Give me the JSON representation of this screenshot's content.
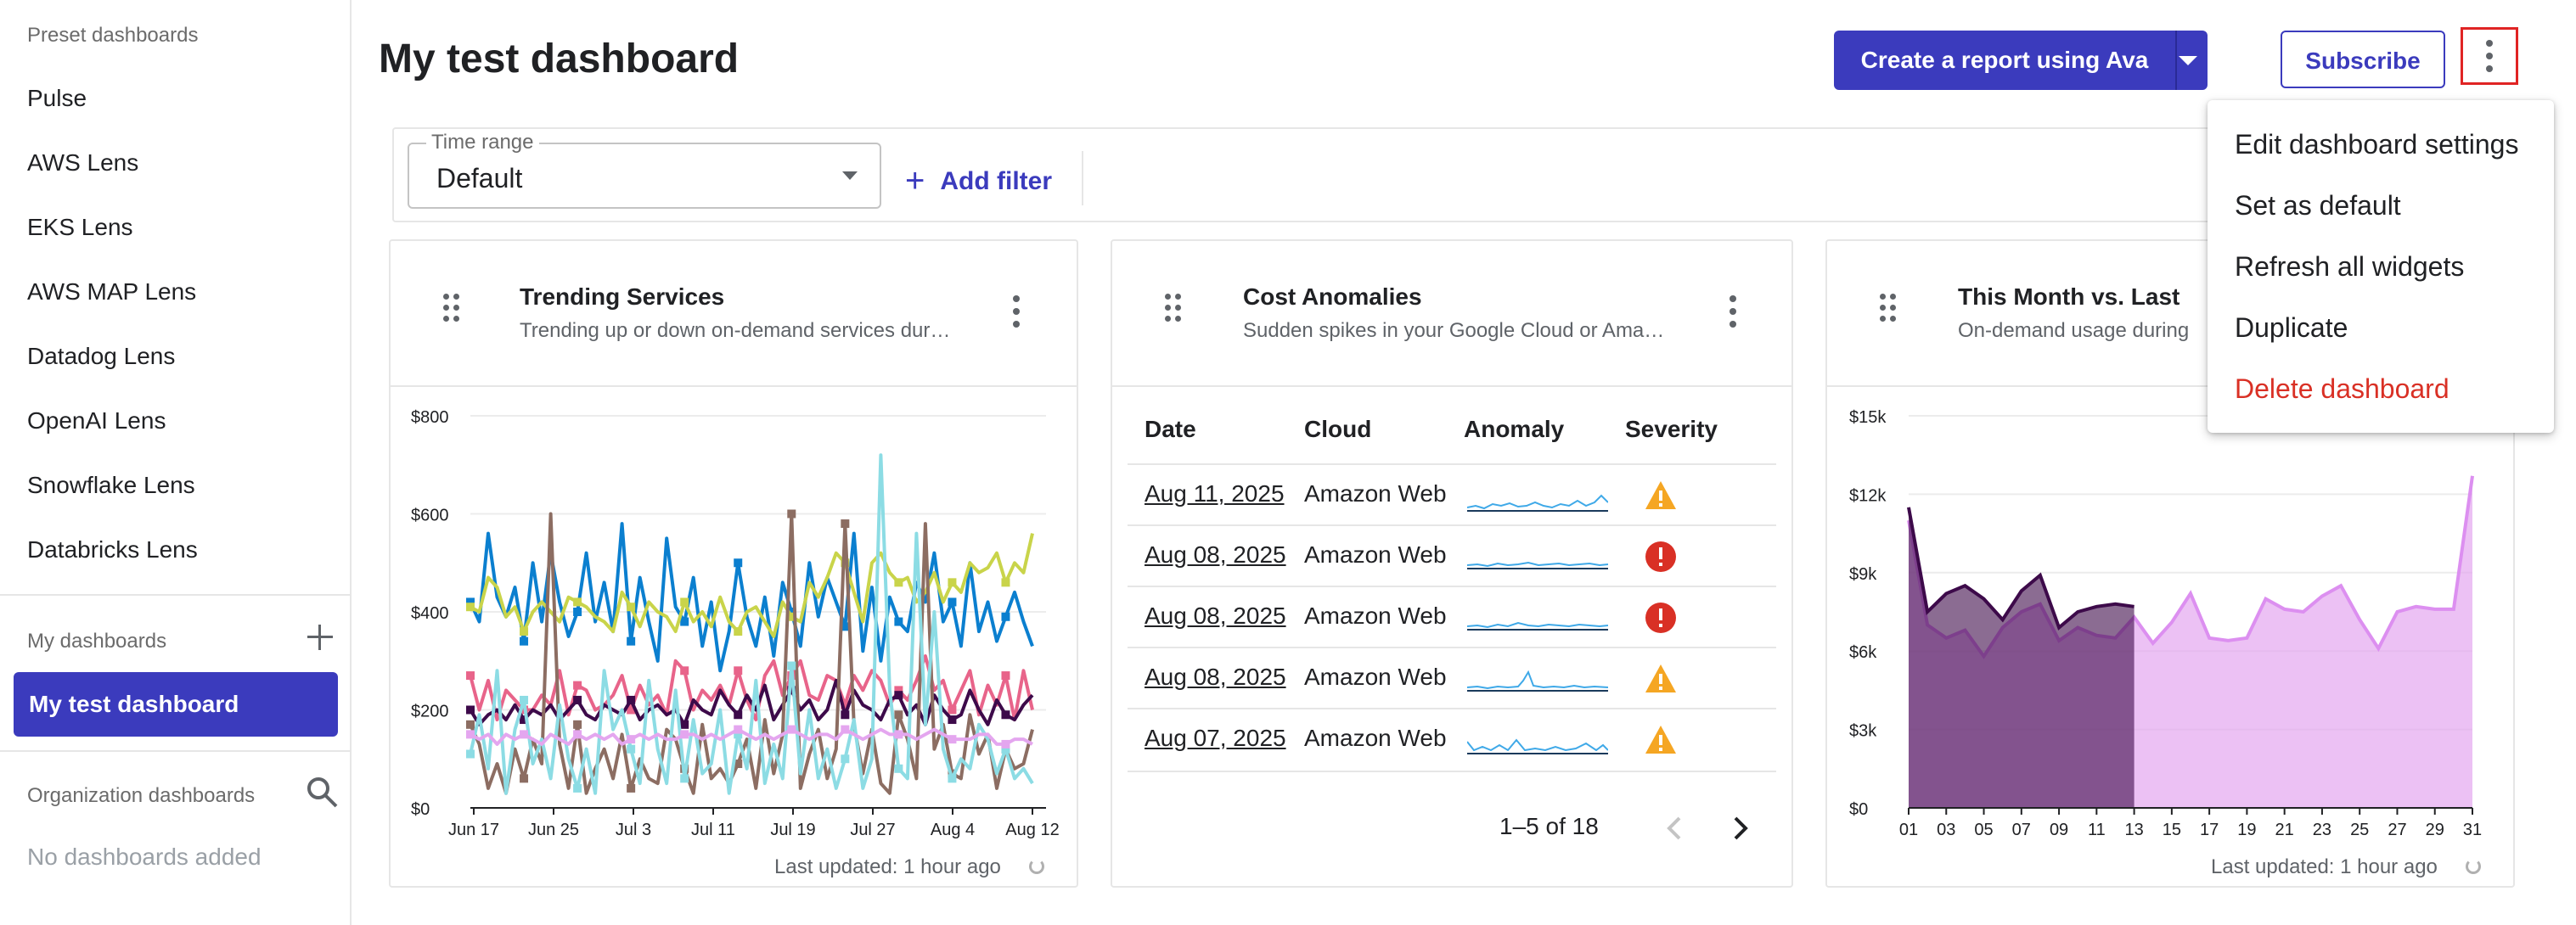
{
  "sidebar": {
    "preset_title": "Preset dashboards",
    "preset_items": [
      "Pulse",
      "AWS Lens",
      "EKS Lens",
      "AWS MAP Lens",
      "Datadog Lens",
      "OpenAI Lens",
      "Snowflake Lens",
      "Databricks Lens"
    ],
    "my_title": "My dashboards",
    "my_active": "My test dashboard",
    "org_title": "Organization dashboards",
    "org_empty": "No dashboards added"
  },
  "header": {
    "title": "My test dashboard",
    "create_report_label": "Create a report using Ava",
    "subscribe_label": "Subscribe"
  },
  "filter": {
    "time_range_label": "Time range",
    "time_range_value": "Default",
    "add_filter_label": "Add filter"
  },
  "menu": {
    "items": [
      "Edit dashboard settings",
      "Set as default",
      "Refresh all widgets",
      "Duplicate",
      "Delete dashboard"
    ]
  },
  "cards": {
    "trending": {
      "title": "Trending Services",
      "subtitle": "Trending up or down on-demand services dur…",
      "last_updated": "Last updated: 1 hour ago"
    },
    "anomalies": {
      "title": "Cost Anomalies",
      "subtitle": "Sudden spikes in your Google Cloud or Ama…",
      "columns": [
        "Date",
        "Cloud",
        "Anomaly",
        "Severity"
      ],
      "rows": [
        {
          "date": "Aug 11, 2025",
          "cloud": "Amazon Web",
          "severity": "warning"
        },
        {
          "date": "Aug 08, 2025",
          "cloud": "Amazon Web",
          "severity": "error"
        },
        {
          "date": "Aug 08, 2025",
          "cloud": "Amazon Web",
          "severity": "error"
        },
        {
          "date": "Aug 08, 2025",
          "cloud": "Amazon Web",
          "severity": "warning"
        },
        {
          "date": "Aug 07, 2025",
          "cloud": "Amazon Web",
          "severity": "warning"
        }
      ],
      "pagination": "1–5 of 18"
    },
    "month": {
      "title": "This Month vs. Last",
      "subtitle": "On-demand usage during",
      "last_updated": "Last updated: 1 hour ago"
    }
  },
  "colors": {
    "primary": "#3b3bbd",
    "danger": "#d93025",
    "warning": "#f5a623"
  },
  "chart_data": [
    {
      "type": "line",
      "y_ticks": [
        "$0",
        "$200",
        "$400",
        "$600",
        "$800"
      ],
      "x_ticks": [
        "Jun 17",
        "Jun 25",
        "Jul 3",
        "Jul 11",
        "Jul 19",
        "Jul 27",
        "Aug 4",
        "Aug 12"
      ],
      "ylim": [
        0,
        800
      ],
      "series": [
        {
          "color": "#0b7fcf",
          "values": [
            420,
            380,
            560,
            430,
            390,
            450,
            340,
            500,
            380,
            520,
            420,
            350,
            400,
            520,
            380,
            460,
            360,
            580,
            340,
            470,
            380,
            300,
            550,
            410,
            380,
            470,
            330,
            420,
            280,
            360,
            500,
            390,
            330,
            430,
            310,
            460,
            400,
            330,
            500,
            390,
            470,
            420,
            370,
            560,
            320,
            450,
            300,
            430,
            380,
            360,
            460,
            420,
            520,
            380,
            420,
            330,
            500,
            360,
            420,
            340,
            390,
            440,
            380,
            330
          ]
        },
        {
          "color": "#c9d44a",
          "values": [
            410,
            400,
            470,
            450,
            390,
            410,
            360,
            400,
            420,
            400,
            380,
            430,
            420,
            410,
            390,
            380,
            360,
            440,
            410,
            370,
            420,
            400,
            390,
            360,
            420,
            380,
            400,
            370,
            430,
            380,
            360,
            400,
            410,
            380,
            350,
            420,
            390,
            380,
            460,
            430,
            470,
            520,
            500,
            440,
            380,
            500,
            520,
            480,
            460,
            470,
            420,
            440,
            480,
            420,
            460,
            440,
            500,
            480,
            490,
            520,
            460,
            500,
            480,
            560
          ]
        },
        {
          "color": "#e8648a",
          "values": [
            270,
            200,
            260,
            180,
            240,
            220,
            200,
            200,
            230,
            210,
            280,
            190,
            250,
            240,
            200,
            210,
            230,
            270,
            200,
            250,
            210,
            230,
            190,
            300,
            280,
            200,
            240,
            220,
            250,
            210,
            280,
            220,
            180,
            270,
            300,
            230,
            270,
            300,
            230,
            220,
            270,
            260,
            210,
            270,
            240,
            280,
            260,
            210,
            240,
            220,
            260,
            310,
            240,
            260,
            200,
            240,
            280,
            190,
            250,
            210,
            270,
            180,
            280,
            200
          ]
        },
        {
          "color": "#3d0a4a",
          "values": [
            200,
            170,
            190,
            200,
            180,
            210,
            180,
            200,
            190,
            210,
            180,
            200,
            220,
            190,
            180,
            210,
            200,
            190,
            220,
            180,
            200,
            210,
            190,
            200,
            170,
            220,
            200,
            190,
            240,
            210,
            190,
            230,
            200,
            250,
            180,
            210,
            240,
            200,
            220,
            180,
            200,
            260,
            190,
            240,
            210,
            200,
            180,
            220,
            230,
            190,
            210,
            170,
            230,
            200,
            180,
            190,
            240,
            200,
            170,
            220,
            190,
            180,
            210,
            230
          ]
        },
        {
          "color": "#8c6d62",
          "values": [
            170,
            130,
            40,
            90,
            30,
            120,
            60,
            140,
            90,
            600,
            130,
            40,
            170,
            30,
            80,
            120,
            60,
            150,
            40,
            100,
            60,
            50,
            160,
            140,
            80,
            30,
            170,
            60,
            80,
            50,
            90,
            140,
            40,
            180,
            70,
            150,
            600,
            40,
            110,
            160,
            60,
            120,
            580,
            170,
            70,
            160,
            50,
            30,
            190,
            140,
            60,
            580,
            120,
            170,
            70,
            60,
            190,
            110,
            150,
            40,
            120,
            80,
            90,
            160
          ]
        },
        {
          "color": "#8cdce4",
          "values": [
            110,
            190,
            80,
            280,
            30,
            160,
            220,
            90,
            140,
            60,
            210,
            100,
            40,
            120,
            30,
            280,
            160,
            200,
            120,
            50,
            260,
            120,
            50,
            240,
            60,
            180,
            70,
            90,
            200,
            30,
            150,
            80,
            260,
            50,
            130,
            60,
            290,
            70,
            200,
            60,
            120,
            40,
            100,
            180,
            40,
            100,
            720,
            240,
            80,
            60,
            560,
            170,
            400,
            120,
            60,
            100,
            80,
            170,
            140,
            70,
            120,
            60,
            80,
            50
          ]
        },
        {
          "color": "#e4a6ef",
          "values": [
            150,
            140,
            150,
            130,
            150,
            140,
            150,
            140,
            130,
            150,
            140,
            130,
            150,
            140,
            150,
            140,
            150,
            130,
            140,
            150,
            140,
            150,
            140,
            140,
            150,
            150,
            140,
            150,
            140,
            150,
            160,
            150,
            140,
            150,
            140,
            150,
            160,
            150,
            140,
            150,
            150,
            140,
            160,
            150,
            140,
            150,
            160,
            150,
            150,
            150,
            140,
            150,
            160,
            150,
            140,
            140,
            140,
            150,
            150,
            130,
            130,
            140,
            140,
            130
          ]
        }
      ]
    },
    {
      "type": "area",
      "y_ticks": [
        "$0",
        "$3k",
        "$6k",
        "$9k",
        "$12k",
        "$15k"
      ],
      "x_ticks": [
        "01",
        "03",
        "05",
        "07",
        "09",
        "11",
        "13",
        "15",
        "17",
        "19",
        "21",
        "23",
        "25",
        "27",
        "29",
        "31"
      ],
      "ylim": [
        0,
        15000
      ],
      "series": [
        {
          "name": "",
          "color": "#3d0a4a",
          "x": [
            1,
            2,
            3,
            4,
            5,
            6,
            7,
            8,
            9,
            10,
            11,
            12,
            13
          ],
          "values": [
            11500,
            7500,
            8200,
            8500,
            8000,
            7200,
            8300,
            8900,
            6900,
            7500,
            7700,
            7800,
            7700
          ]
        },
        {
          "name": "",
          "color": "#e4a6ef",
          "x": [
            1,
            2,
            3,
            4,
            5,
            6,
            7,
            8,
            9,
            10,
            11,
            12,
            13,
            14,
            15,
            16,
            17,
            18,
            19,
            20,
            21,
            22,
            23,
            24,
            25,
            26,
            27,
            28,
            29,
            30,
            31
          ],
          "values": [
            11000,
            7000,
            6500,
            6800,
            5800,
            6900,
            7500,
            7800,
            6400,
            6900,
            6600,
            6500,
            7300,
            6300,
            7100,
            8200,
            6500,
            6400,
            6500,
            8000,
            7600,
            7500,
            8100,
            8500,
            7200,
            6100,
            7500,
            7700,
            7600,
            7600,
            12700
          ]
        }
      ]
    }
  ]
}
